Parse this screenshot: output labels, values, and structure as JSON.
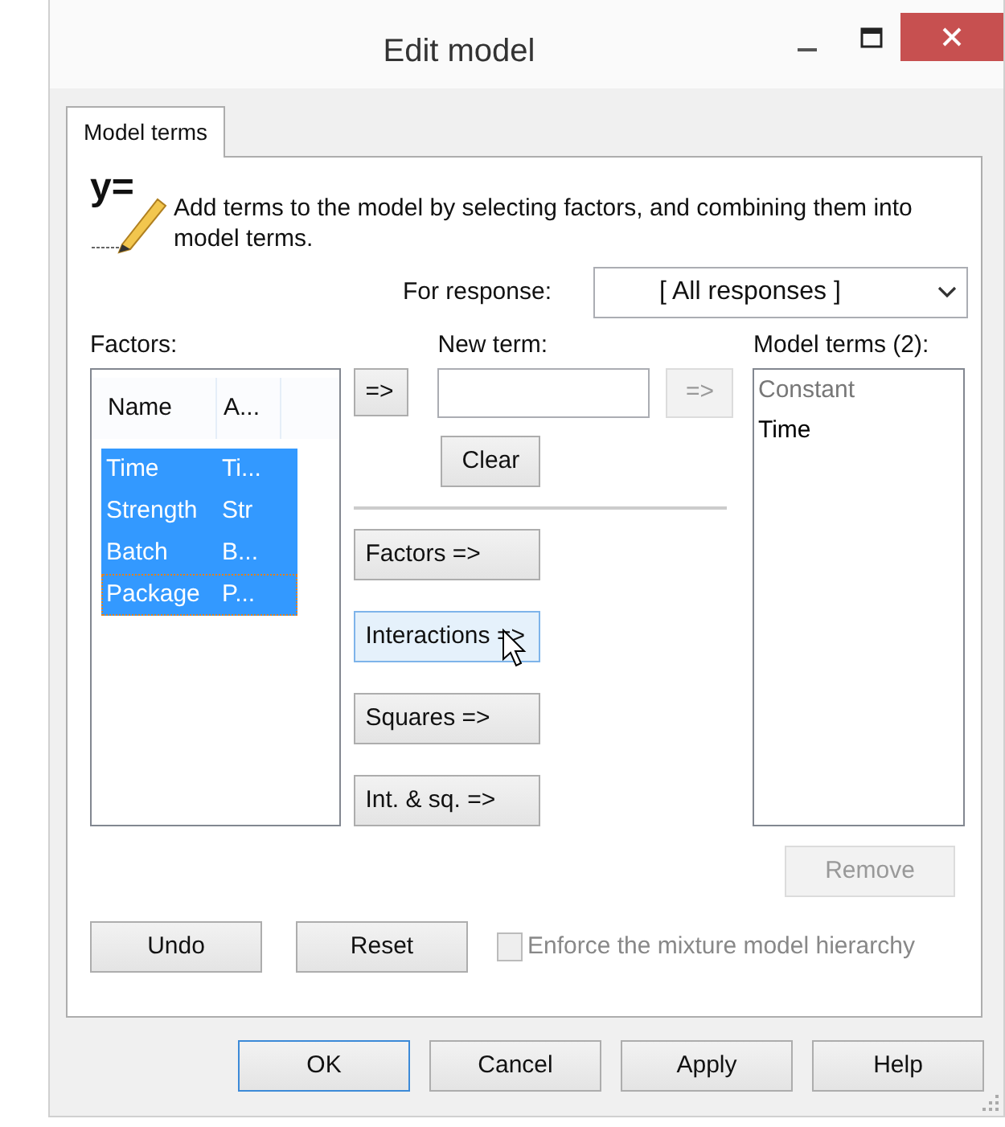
{
  "window": {
    "title": "Edit model"
  },
  "tabs": [
    {
      "label": "Model terms",
      "selected": true
    }
  ],
  "formula_icon": {
    "text": "y="
  },
  "description": "Add terms to the model by selecting factors, and combining them into model terms.",
  "response": {
    "label": "For response:",
    "value": "[ All responses ]"
  },
  "factors": {
    "label": "Factors:",
    "columns": [
      "Name",
      "A..."
    ],
    "rows": [
      {
        "name": "Time",
        "abbr": "Ti...",
        "selected": true,
        "focused": false
      },
      {
        "name": "Strength",
        "abbr": "Str",
        "selected": true,
        "focused": false
      },
      {
        "name": "Batch",
        "abbr": "B...",
        "selected": true,
        "focused": false
      },
      {
        "name": "Package",
        "abbr": "P...",
        "selected": true,
        "focused": true
      }
    ]
  },
  "add_button": {
    "label": "=>",
    "disabled": false
  },
  "new_term": {
    "label": "New term:"
  },
  "new_term_add": {
    "label": "=>",
    "disabled": true
  },
  "clear_button": {
    "label": "Clear"
  },
  "generate_buttons": [
    {
      "label": "Factors =>",
      "hovered": false
    },
    {
      "label": "Interactions =>",
      "hovered": true
    },
    {
      "label": "Squares =>",
      "hovered": false
    },
    {
      "label": "Int. & sq. =>",
      "hovered": false
    }
  ],
  "model_terms": {
    "label": "Model terms (2):",
    "items": [
      {
        "text": "Constant",
        "disabled": true
      },
      {
        "text": "Time",
        "disabled": false
      }
    ]
  },
  "remove_button": {
    "label": "Remove",
    "disabled": true
  },
  "undo_button": {
    "label": "Undo"
  },
  "reset_button": {
    "label": "Reset"
  },
  "hierarchy": {
    "label": "Enforce the mixture model hierarchy",
    "checked": false,
    "disabled": true
  },
  "footer_buttons": [
    {
      "label": "OK",
      "default": true
    },
    {
      "label": "Cancel",
      "default": false
    },
    {
      "label": "Apply",
      "default": false
    },
    {
      "label": "Help",
      "default": false
    }
  ]
}
